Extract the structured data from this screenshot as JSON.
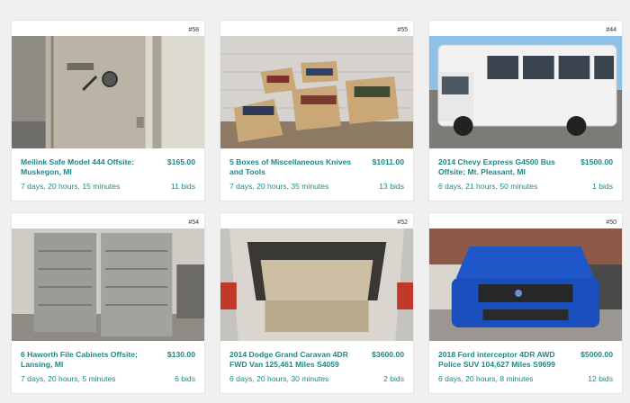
{
  "listings": [
    {
      "lot": "#58",
      "title": "Meilink Safe Model 444 Offsite: Muskegon, MI",
      "price": "$165.00",
      "time_left": "7 days, 20 hours, 15 minutes",
      "bids": "11 bids",
      "image_subject": "safe"
    },
    {
      "lot": "#55",
      "title": "5 Boxes of Miscellaneous Knives and Tools",
      "price": "$1011.00",
      "time_left": "7 days, 20 hours, 35 minutes",
      "bids": "13 bids",
      "image_subject": "boxes"
    },
    {
      "lot": "#44",
      "title": "2014 Chevy Express G4500 Bus Offsite; Mt. Pleasant, MI",
      "price": "$1500.00",
      "time_left": "6 days, 21 hours, 50 minutes",
      "bids": "1 bids",
      "image_subject": "bus"
    },
    {
      "lot": "#54",
      "title": "6 Haworth File Cabinets Offsite; Lansing, MI",
      "price": "$130.00",
      "time_left": "7 days, 20 hours, 5 minutes",
      "bids": "6 bids",
      "image_subject": "cabinets"
    },
    {
      "lot": "#52",
      "title": "2014 Dodge Grand Caravan 4DR FWD Van 125,461 Miles S4059",
      "price": "$3600.00",
      "time_left": "6 days, 20 hours, 30 minutes",
      "bids": "2 bids",
      "image_subject": "van"
    },
    {
      "lot": "#50",
      "title": "2018 Ford interceptor 4DR AWD Police SUV 104,627 Miles S9699",
      "price": "$5000.00",
      "time_left": "6 days, 20 hours, 8 minutes",
      "bids": "12 bids",
      "image_subject": "suv"
    }
  ],
  "colors": {
    "accent": "#1b8a86",
    "background": "#f0f0f0",
    "card": "#ffffff"
  }
}
